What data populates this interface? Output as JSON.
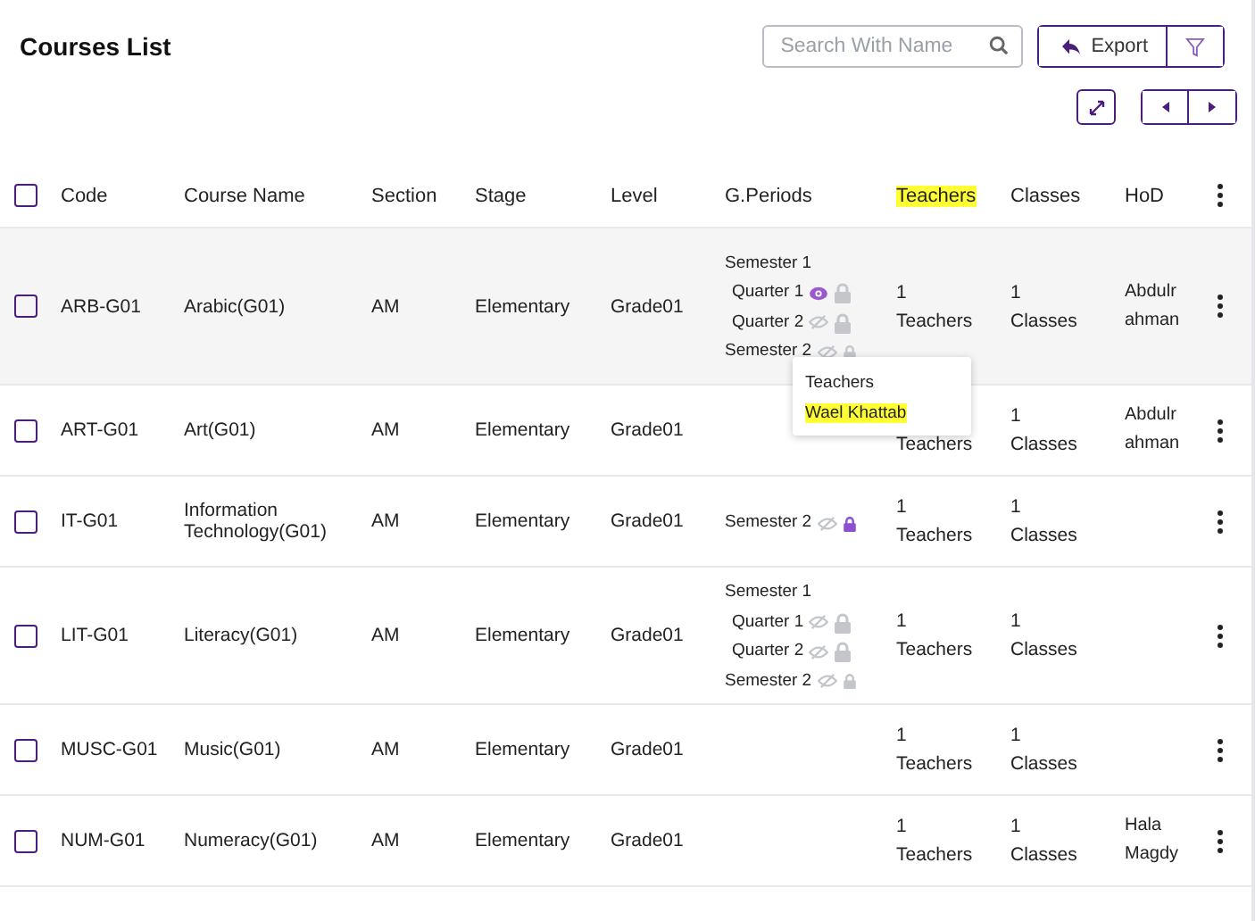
{
  "title": "Courses List",
  "search": {
    "placeholder": "Search With Name"
  },
  "export_button": "Export",
  "table": {
    "select_all_checked": false,
    "columns": [
      {
        "label": "Code",
        "highlighted": false
      },
      {
        "label": "Course Name",
        "highlighted": false
      },
      {
        "label": "Section",
        "highlighted": false
      },
      {
        "label": "Stage",
        "highlighted": false
      },
      {
        "label": "Level",
        "highlighted": false
      },
      {
        "label": "G.Periods",
        "highlighted": false
      },
      {
        "label": "Teachers",
        "highlighted": true
      },
      {
        "label": "Classes",
        "highlighted": false
      },
      {
        "label": "HoD",
        "highlighted": false
      }
    ],
    "rows": [
      {
        "checked": false,
        "hovered": true,
        "code": "ARB-G01",
        "name": "Arabic(G01)",
        "section": "AM",
        "stage": "Elementary",
        "level": "Grade01",
        "periods": [
          {
            "kind": "semester",
            "label": "Semester 1"
          },
          {
            "kind": "quarter",
            "label": "Quarter 1",
            "visible": true,
            "locked": false
          },
          {
            "kind": "quarter",
            "label": "Quarter 2",
            "visible": false,
            "locked": false
          },
          {
            "kind": "semester",
            "label": "Semester 2",
            "visible": false,
            "locked": false
          }
        ],
        "teachers_count": "1",
        "teachers_label": "Teachers",
        "classes_count": "1",
        "classes_label": "Classes",
        "hod": "Abdulr ahman"
      },
      {
        "checked": false,
        "hovered": false,
        "code": "ART-G01",
        "name": "Art(G01)",
        "section": "AM",
        "stage": "Elementary",
        "level": "Grade01",
        "teachers_label": "Teachers",
        "classes_count": "1",
        "classes_label": "Classes",
        "hod": "Abdulr ahman"
      },
      {
        "checked": false,
        "hovered": false,
        "code": "IT-G01",
        "name": "Information Technology(G01)",
        "section": "AM",
        "stage": "Elementary",
        "level": "Grade01",
        "periods": [
          {
            "kind": "semester",
            "label": "Semester 2",
            "visible": false,
            "locked": true
          }
        ],
        "teachers_count": "1",
        "teachers_label": "Teachers",
        "classes_count": "1",
        "classes_label": "Classes"
      },
      {
        "checked": false,
        "hovered": false,
        "code": "LIT-G01",
        "name": "Literacy(G01)",
        "section": "AM",
        "stage": "Elementary",
        "level": "Grade01",
        "periods": [
          {
            "kind": "semester",
            "label": "Semester 1"
          },
          {
            "kind": "quarter",
            "label": "Quarter 1",
            "visible": false,
            "locked": false
          },
          {
            "kind": "quarter",
            "label": "Quarter 2",
            "visible": false,
            "locked": false
          },
          {
            "kind": "semester",
            "label": "Semester 2",
            "visible": false,
            "locked": false
          }
        ],
        "teachers_count": "1",
        "teachers_label": "Teachers",
        "classes_count": "1",
        "classes_label": "Classes"
      },
      {
        "checked": false,
        "hovered": false,
        "code": "MUSC-G01",
        "name": "Music(G01)",
        "section": "AM",
        "stage": "Elementary",
        "level": "Grade01",
        "teachers_count": "1",
        "teachers_label": "Teachers",
        "classes_count": "1",
        "classes_label": "Classes"
      },
      {
        "checked": false,
        "hovered": false,
        "code": "NUM-G01",
        "name": "Numeracy(G01)",
        "section": "AM",
        "stage": "Elementary",
        "level": "Grade01",
        "teachers_count": "1",
        "teachers_label": "Teachers",
        "classes_count": "1",
        "classes_label": "Classes",
        "hod": "Hala Magdy"
      }
    ]
  },
  "teachers_popup": {
    "title": "Teachers",
    "items": [
      {
        "name": "Wael Khattab",
        "highlighted": true
      }
    ]
  }
}
